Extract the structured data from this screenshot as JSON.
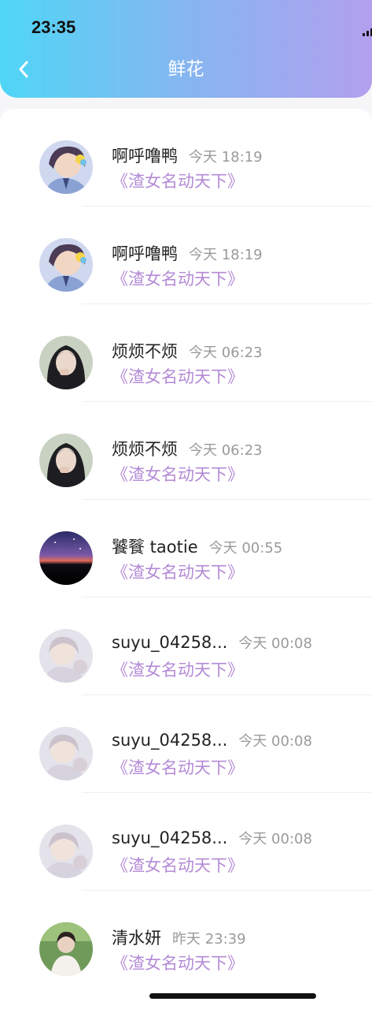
{
  "status_bar": {
    "time": "23:35"
  },
  "header": {
    "title": "鲜花"
  },
  "items": [
    {
      "name": "啊呼噜鸭",
      "time": "今天 18:19",
      "work": "《渣女名动天下》",
      "avatar": "anime-boy-avatar"
    },
    {
      "name": "啊呼噜鸭",
      "time": "今天 18:19",
      "work": "《渣女名动天下》",
      "avatar": "anime-boy-avatar"
    },
    {
      "name": "烦烦不烦",
      "time": "今天 06:23",
      "work": "《渣女名动天下》",
      "avatar": "girl-photo-avatar"
    },
    {
      "name": "烦烦不烦",
      "time": "今天 06:23",
      "work": "《渣女名动天下》",
      "avatar": "girl-photo-avatar"
    },
    {
      "name": "饕餮 taotie",
      "time": "今天 00:55",
      "work": "《渣女名动天下》",
      "avatar": "night-sky-avatar"
    },
    {
      "name": "suyu_04258...",
      "time": "今天 00:08",
      "work": "《渣女名动天下》",
      "avatar": "faded-anime-avatar"
    },
    {
      "name": "suyu_04258...",
      "time": "今天 00:08",
      "work": "《渣女名动天下》",
      "avatar": "faded-anime-avatar"
    },
    {
      "name": "suyu_04258...",
      "time": "今天 00:08",
      "work": "《渣女名动天下》",
      "avatar": "faded-anime-avatar"
    },
    {
      "name": "清水妍",
      "time": "昨天 23:39",
      "work": "《渣女名动天下》",
      "avatar": "boy-photo-avatar"
    }
  ],
  "colors": {
    "header_gradient": [
      "#4fd6f6",
      "#86b6f1",
      "#b2a0ee"
    ],
    "work_title": "#b48ad6",
    "timestamp": "#9a9a9a"
  }
}
